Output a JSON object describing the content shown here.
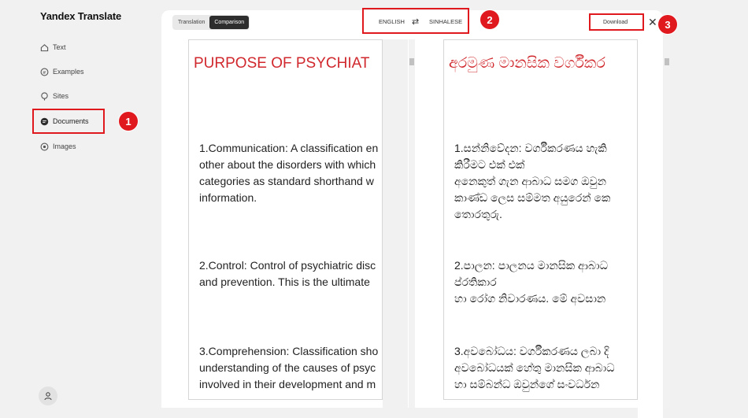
{
  "sidebar": {
    "brand": "Yandex Translate",
    "items": [
      {
        "label": "Text",
        "icon": "home-icon"
      },
      {
        "label": "Examples",
        "icon": "examples-icon"
      },
      {
        "label": "Sites",
        "icon": "sites-icon"
      },
      {
        "label": "Documents",
        "icon": "document-icon"
      },
      {
        "label": "Images",
        "icon": "image-icon"
      }
    ]
  },
  "markers": [
    "1",
    "2",
    "3"
  ],
  "toolbar": {
    "tab_translation": "Translation",
    "tab_comparison": "Comparison",
    "source_lang": "ENGLISH",
    "target_lang": "SINHALESE",
    "download_label": "Download"
  },
  "source_doc": {
    "title": "PURPOSE OF PSYCHIAT",
    "paragraphs": [
      [
        "1.Communication: A classification en",
        "other about the disorders with which",
        "categories as standard shorthand w",
        "information."
      ],
      [
        "2.Control: Control of psychiatric disc",
        "and prevention. This is the ultimate"
      ],
      [
        "3.Comprehension: Classification sho",
        "understanding of the causes of psyc",
        "involved in their development and m"
      ]
    ]
  },
  "target_doc": {
    "title": "අරමුණ මානසික වර්ගීකර",
    "paragraphs": [
      [
        "1.සන්නිවේදන: වර්ගීකරණය හැකි",
        "කිරීමට එක් එක්",
        "අනෙකුත් ගැන ආබාධ සමග ඔවුන",
        "කාණ්ඩ ලෙස සම්මත අයුරෙන් කෙ",
        "තොරතුරු."
      ],
      [
        "2.පාලන: පාලනය මානසික ආබාධ",
        "ප්රතිකාර",
        "හා රෝග නිවාරණය. මේ අවසාන"
      ],
      [
        "3.අවබෝධය: වර්ගීකරණය ලබා දි",
        "අවබෝධයක් හේතු මානසික ආබාධ",
        "හා සම්බන්ධ ඔවුන්ගේ සංවර්ධන"
      ]
    ]
  },
  "colors": {
    "accent_red": "#e0191f",
    "title_red": "#d0282d"
  }
}
